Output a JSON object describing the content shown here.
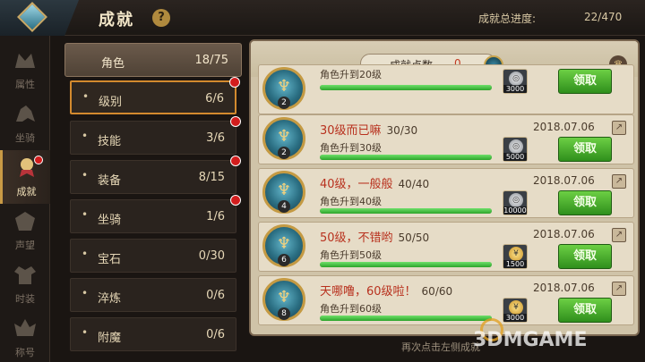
{
  "header": {
    "title": "成就",
    "help_symbol": "?",
    "progress_label": "成就总进度:",
    "progress_value": "22/470"
  },
  "leftnav": {
    "items": [
      {
        "label": "属性",
        "icon": "attribute-icon",
        "active": false
      },
      {
        "label": "坐骑",
        "icon": "mount-icon",
        "active": false
      },
      {
        "label": "成就",
        "icon": "achievement-icon",
        "active": true
      },
      {
        "label": "声望",
        "icon": "reputation-icon",
        "active": false
      },
      {
        "label": "时装",
        "icon": "fashion-icon",
        "active": false
      },
      {
        "label": "称号",
        "icon": "title-badge-icon",
        "active": false
      }
    ]
  },
  "categories": {
    "header": {
      "label": "角色",
      "value": "18/75"
    },
    "items": [
      {
        "label": "级别",
        "value": "6/6",
        "dot": true
      },
      {
        "label": "技能",
        "value": "3/6",
        "dot": true
      },
      {
        "label": "装备",
        "value": "8/15",
        "dot": true
      },
      {
        "label": "坐骑",
        "value": "1/6",
        "dot": true
      },
      {
        "label": "宝石",
        "value": "0/30",
        "dot": false
      },
      {
        "label": "淬炼",
        "value": "0/6",
        "dot": false
      },
      {
        "label": "附魔",
        "value": "0/6",
        "dot": false
      }
    ]
  },
  "panel": {
    "points_label": "成就点数",
    "points_value": "0",
    "rows": [
      {
        "title": "",
        "count": "",
        "date": "",
        "desc": "角色升到20级",
        "level": "2",
        "reward": "3000",
        "coin": "silver",
        "claim": "领取",
        "progress": 1.0
      },
      {
        "title": "30级而已嘛",
        "count": "30/30",
        "date": "2018.07.06",
        "desc": "角色升到30级",
        "level": "2",
        "reward": "5000",
        "coin": "silver",
        "claim": "领取",
        "progress": 1.0
      },
      {
        "title": "40级，一般般",
        "count": "40/40",
        "date": "2018.07.06",
        "desc": "角色升到40级",
        "level": "4",
        "reward": "10000",
        "coin": "silver",
        "claim": "领取",
        "progress": 1.0
      },
      {
        "title": "50级，不错哟",
        "count": "50/50",
        "date": "2018.07.06",
        "desc": "角色升到50级",
        "level": "6",
        "reward": "1500",
        "coin": "gold",
        "claim": "领取",
        "progress": 1.0
      },
      {
        "title": "天哪噜，60级啦！",
        "count": "60/60",
        "date": "2018.07.06",
        "desc": "角色升到60级",
        "level": "8",
        "reward": "3000",
        "coin": "gold",
        "claim": "领取",
        "progress": 1.0
      }
    ]
  },
  "footer": {
    "hint": "再次点击左侧成就",
    "watermark": "3DMGAME"
  }
}
